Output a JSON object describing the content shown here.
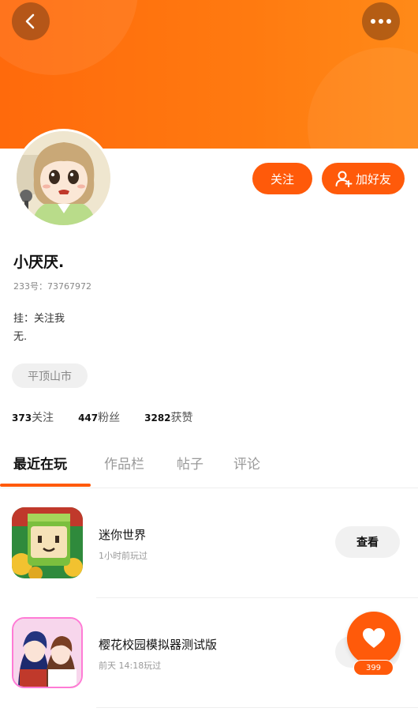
{
  "header": {
    "back_icon": "chevron-left-icon",
    "more_icon": "more-dots-icon",
    "bg_color": "#ff6a0c"
  },
  "profile": {
    "nickname": "小厌厌.",
    "uid": "233号：73767972",
    "bio_line1": "挂：关注我",
    "bio_line2": "无.",
    "location": "平顶山市",
    "follow_label": "关注",
    "add_friend_label": "加好友",
    "accent": "#ff5a0a"
  },
  "stats": {
    "following_count": "373",
    "following_label": "关注",
    "fans_count": "447",
    "fans_label": "粉丝",
    "likes_count": "3282",
    "likes_label": "获赞"
  },
  "tabs": [
    {
      "label": "最近在玩",
      "active": true
    },
    {
      "label": "作品栏",
      "active": false
    },
    {
      "label": "帖子",
      "active": false
    },
    {
      "label": "评论",
      "active": false
    }
  ],
  "games": [
    {
      "title": "迷你世界",
      "subtitle": "1小时前玩过",
      "button": "查看"
    },
    {
      "title": "樱花校园模拟器测试版",
      "subtitle": "前天 14:18玩过",
      "button": "查看",
      "badge": "测试版"
    }
  ],
  "like_fab": {
    "count": "399"
  }
}
